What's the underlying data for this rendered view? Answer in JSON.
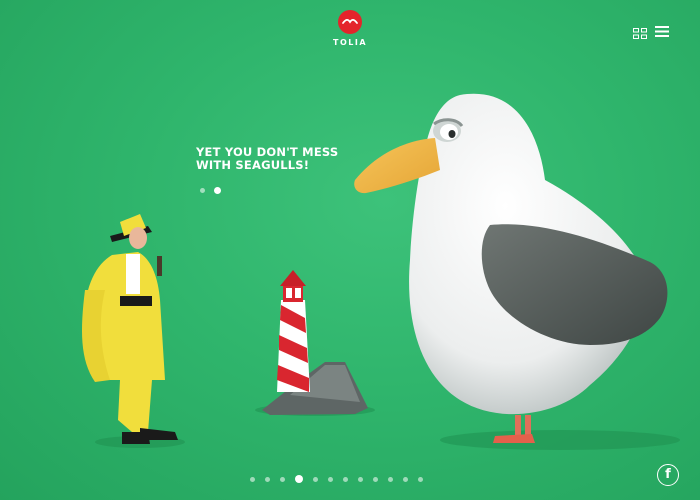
{
  "brand": {
    "name": "TOLIA",
    "accent": "#e4242b",
    "background": "#2fb56c"
  },
  "header": {
    "grid_icon": "grid-icon",
    "menu_icon": "hamburger-menu-icon"
  },
  "hero": {
    "headline_line1": "YET YOU DON'T MESS",
    "headline_line2": "WITH SEAGULLS!",
    "slide_count": 2,
    "active_slide": 2
  },
  "pagination": {
    "count": 12,
    "active": 4
  },
  "social": {
    "facebook_label": "f"
  }
}
